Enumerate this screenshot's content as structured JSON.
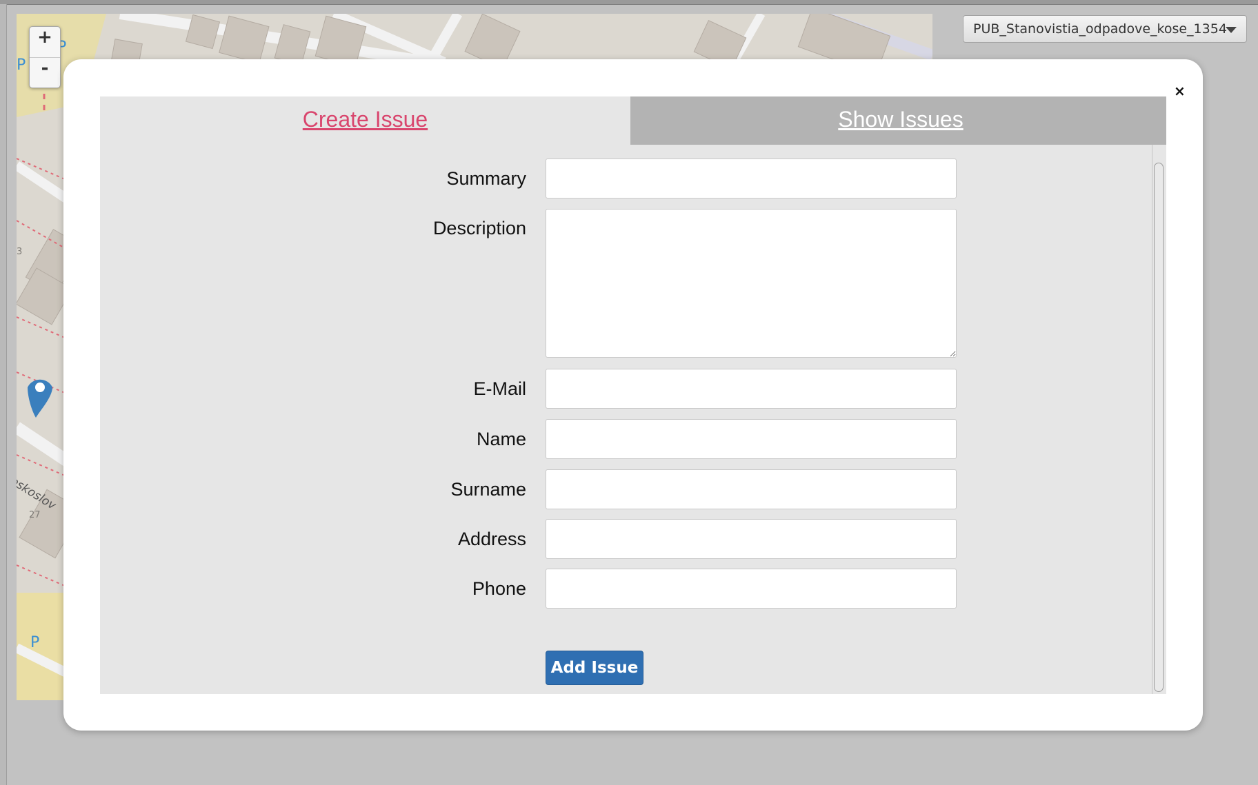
{
  "map": {
    "zoom_in_label": "+",
    "zoom_out_label": "-",
    "street_label": "eskoslov",
    "house_numbers": [
      "3",
      "27"
    ],
    "parking_label": "P"
  },
  "layer_select": {
    "selected": "PUB_Stanovistia_odpadove_kose_1354"
  },
  "dialog": {
    "close_label": "×",
    "tabs": [
      {
        "label": "Create Issue",
        "active": true
      },
      {
        "label": "Show Issues",
        "active": false
      }
    ],
    "form": {
      "summary": {
        "label": "Summary",
        "value": ""
      },
      "description": {
        "label": "Description",
        "value": ""
      },
      "email": {
        "label": "E-Mail",
        "value": ""
      },
      "name": {
        "label": "Name",
        "value": ""
      },
      "surname": {
        "label": "Surname",
        "value": ""
      },
      "address": {
        "label": "Address",
        "value": ""
      },
      "phone": {
        "label": "Phone",
        "value": ""
      },
      "submit_label": "Add Issue"
    }
  },
  "colors": {
    "active_tab_text": "#d9456d",
    "inactive_tab_bg": "#b3b3b3",
    "panel_bg": "#e6e6e6",
    "button_bg": "#2f6fb2"
  }
}
